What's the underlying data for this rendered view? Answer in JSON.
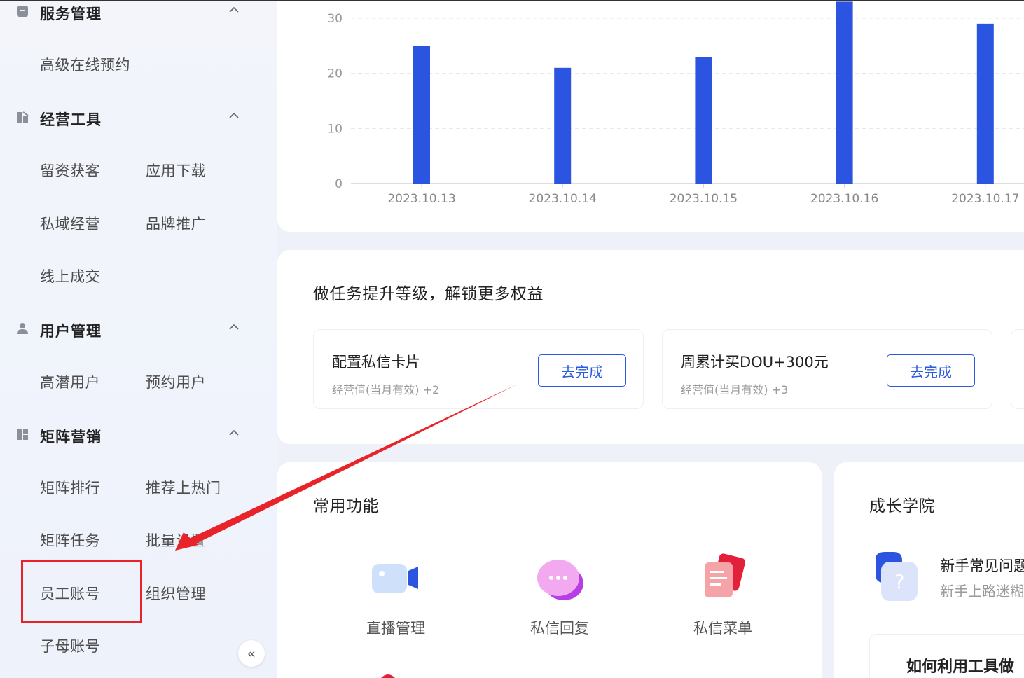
{
  "sidebar": {
    "sections": [
      {
        "title": "服务管理",
        "icon": "service-icon",
        "items": [
          "高级在线预约"
        ]
      },
      {
        "title": "经营工具",
        "icon": "tools-icon",
        "items": [
          "留资获客",
          "应用下载",
          "私域经营",
          "品牌推广",
          "线上成交"
        ]
      },
      {
        "title": "用户管理",
        "icon": "user-icon",
        "items": [
          "高潜用户",
          "预约用户"
        ]
      },
      {
        "title": "矩阵营销",
        "icon": "matrix-icon",
        "items": [
          "矩阵排行",
          "推荐上热门",
          "矩阵任务",
          "批量设置",
          "员工账号",
          "组织管理",
          "子母账号"
        ]
      }
    ],
    "collapse_label": "«"
  },
  "chart_data": {
    "type": "bar",
    "categories": [
      "2023.10.13",
      "2023.10.14",
      "2023.10.15",
      "2023.10.16",
      "2023.10.17"
    ],
    "values": [
      25,
      21,
      23,
      33,
      29
    ],
    "ylim": [
      0,
      30
    ],
    "yticks": [
      "0",
      "10",
      "20",
      "30"
    ],
    "color": "#2b55e0",
    "grid": true
  },
  "tasks": {
    "title": "做任务提升等级，解锁更多权益",
    "items": [
      {
        "name": "配置私信卡片",
        "reward": "经营值(当月有效) +2",
        "button": "去完成"
      },
      {
        "name": "周累计买DOU+300元",
        "reward": "经营值(当月有效) +3",
        "button": "去完成"
      }
    ]
  },
  "functions": {
    "title": "常用功能",
    "items": [
      {
        "label": "直播管理",
        "icon": "live-camera-icon"
      },
      {
        "label": "私信回复",
        "icon": "message-bubble-icon"
      },
      {
        "label": "私信菜单",
        "icon": "message-menu-icon"
      }
    ]
  },
  "academy": {
    "title": "成长学院",
    "faq_title": "新手常见问题",
    "faq_sub": "新手上路迷糊",
    "article_title": "如何利用工具做"
  },
  "annotation": {
    "highlight_color": "#e8242a"
  }
}
